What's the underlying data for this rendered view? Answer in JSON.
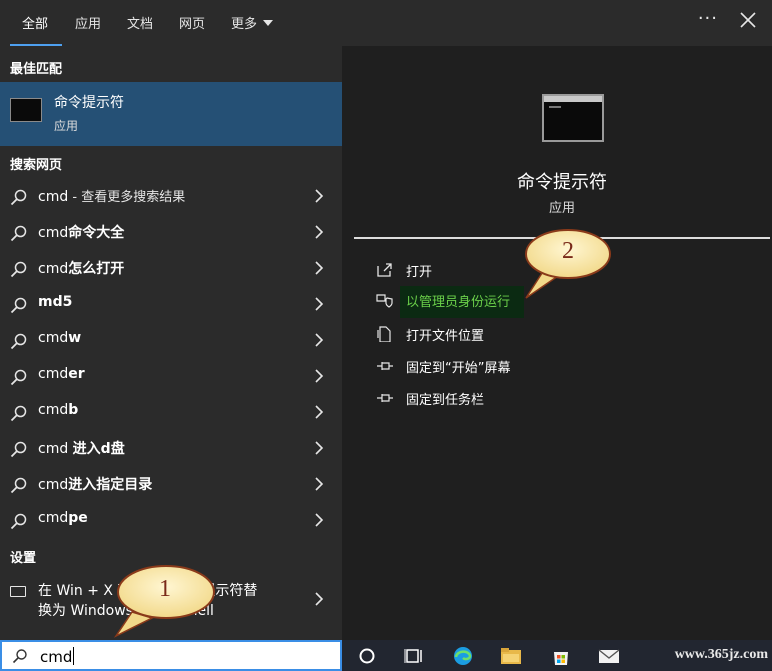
{
  "tabs": [
    {
      "label": "全部",
      "active": true
    },
    {
      "label": "应用",
      "active": false
    },
    {
      "label": "文档",
      "active": false
    },
    {
      "label": "网页",
      "active": false
    },
    {
      "label": "更多",
      "active": false
    }
  ],
  "header": {
    "more_options": "···"
  },
  "best_match": {
    "section_label": "最佳匹配",
    "title": "命令提示符",
    "subtitle": "应用"
  },
  "web_search": {
    "section_label": "搜索网页",
    "items": [
      {
        "plain": "cmd",
        "bold": "",
        "small": " - 查看更多搜索结果"
      },
      {
        "plain": "cmd",
        "bold": "命令大全",
        "small": ""
      },
      {
        "plain": "cmd",
        "bold": "怎么打开",
        "small": ""
      },
      {
        "plain": "",
        "bold": "md5",
        "small": ""
      },
      {
        "plain": "cmd",
        "bold": "w",
        "small": ""
      },
      {
        "plain": "cmd",
        "bold": "er",
        "small": ""
      },
      {
        "plain": "cmd",
        "bold": "b",
        "small": ""
      },
      {
        "plain": "cmd ",
        "bold": "进入d盘",
        "small": ""
      },
      {
        "plain": "cmd",
        "bold": "进入指定目录",
        "small": ""
      },
      {
        "plain": "cmd",
        "bold": "pe",
        "small": ""
      }
    ]
  },
  "settings": {
    "section_label": "设置",
    "item_line1": "在 Win + X 菜单中将命令提示符替",
    "item_line2": "换为 Windows PowerShell"
  },
  "search": {
    "value": "cmd"
  },
  "detail": {
    "title": "命令提示符",
    "subtitle": "应用",
    "actions": [
      {
        "label": "打开",
        "icon": "open-icon"
      },
      {
        "label": "以管理员身份运行",
        "icon": "shield-icon"
      },
      {
        "label": "打开文件位置",
        "icon": "file-location-icon"
      },
      {
        "label": "固定到“开始”屏幕",
        "icon": "pin-icon"
      },
      {
        "label": "固定到任务栏",
        "icon": "pin-icon"
      }
    ]
  },
  "callouts": [
    "1",
    "2"
  ],
  "watermark": "www.365jz.com",
  "colors": {
    "accent": "#3a8ee6",
    "selected": "#255075",
    "admin_highlight": "#6bd04a"
  }
}
